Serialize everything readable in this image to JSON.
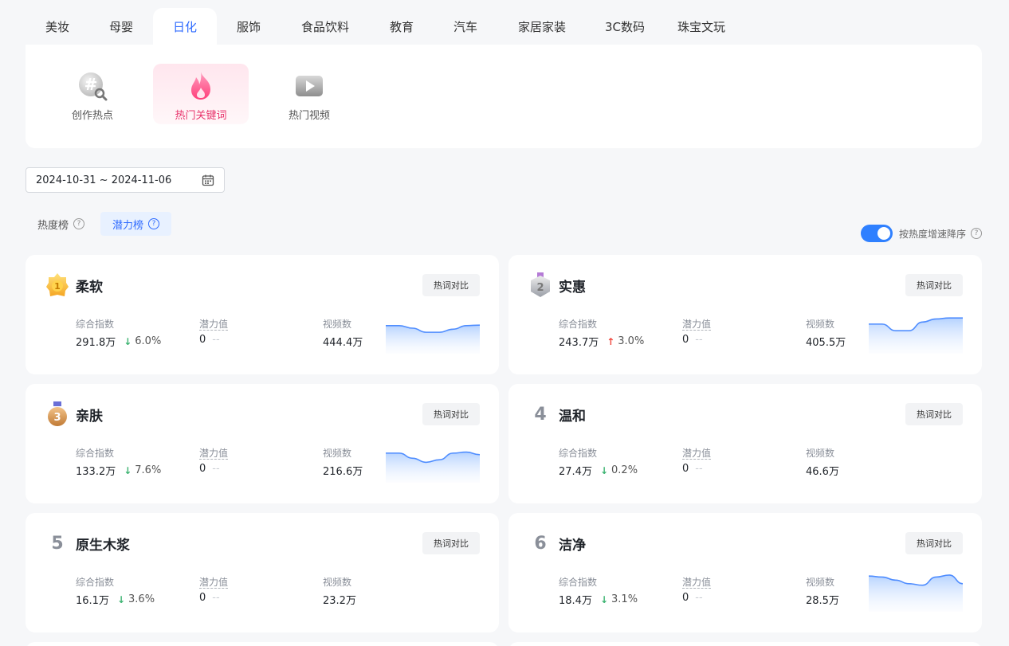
{
  "category_tabs": [
    {
      "label": "美妆",
      "active": false
    },
    {
      "label": "母婴",
      "active": false
    },
    {
      "label": "日化",
      "active": true
    },
    {
      "label": "服饰",
      "active": false
    },
    {
      "label": "食品饮料",
      "active": false
    },
    {
      "label": "教育",
      "active": false
    },
    {
      "label": "汽车",
      "active": false
    },
    {
      "label": "家居家装",
      "active": false
    },
    {
      "label": "3C数码",
      "active": false
    },
    {
      "label": "珠宝文玩",
      "active": false
    }
  ],
  "sub_nav": [
    {
      "label": "创作热点",
      "icon": "hashtag-search-icon",
      "active": false
    },
    {
      "label": "热门关键词",
      "icon": "fire-icon",
      "active": true
    },
    {
      "label": "热门视频",
      "icon": "video-play-icon",
      "active": false
    }
  ],
  "date_range": {
    "value": "2024-10-31 ~ 2024-11-06",
    "icon": "calendar-icon"
  },
  "rank_tabs": [
    {
      "label": "热度榜",
      "active": false
    },
    {
      "label": "潜力榜",
      "active": true
    }
  ],
  "sort_toggle": {
    "label": "按热度增速降序",
    "on": true
  },
  "stat_labels": {
    "composite": "综合指数",
    "potential": "潜力值",
    "videos": "视频数"
  },
  "compare_label": "热词对比",
  "colors": {
    "accent": "#2f6bff",
    "up": "#f0463c",
    "down": "#3cb371",
    "active_sub": "#e8336b"
  },
  "cards": [
    {
      "rank": "1",
      "keyword": "柔软",
      "composite": "291.8万",
      "trend": "down",
      "trend_pct": "6.0%",
      "potential": "0",
      "potential_change": "--",
      "videos": "444.4万",
      "spark": [
        0.55,
        0.55,
        0.5,
        0.42,
        0.42,
        0.48,
        0.55,
        0.56
      ],
      "has_spark": true
    },
    {
      "rank": "2",
      "keyword": "实惠",
      "composite": "243.7万",
      "trend": "up",
      "trend_pct": "3.0%",
      "potential": "0",
      "potential_change": "--",
      "videos": "405.5万",
      "spark": [
        0.58,
        0.58,
        0.45,
        0.45,
        0.62,
        0.68,
        0.7,
        0.7
      ],
      "has_spark": true
    },
    {
      "rank": "3",
      "keyword": "亲肤",
      "composite": "133.2万",
      "trend": "down",
      "trend_pct": "7.6%",
      "potential": "0",
      "potential_change": "--",
      "videos": "216.6万",
      "spark": [
        0.58,
        0.58,
        0.48,
        0.4,
        0.45,
        0.58,
        0.6,
        0.55
      ],
      "has_spark": true
    },
    {
      "rank": "4",
      "keyword": "温和",
      "composite": "27.4万",
      "trend": "down",
      "trend_pct": "0.2%",
      "potential": "0",
      "potential_change": "--",
      "videos": "46.6万",
      "spark": [],
      "has_spark": false
    },
    {
      "rank": "5",
      "keyword": "原生木浆",
      "composite": "16.1万",
      "trend": "down",
      "trend_pct": "3.6%",
      "potential": "0",
      "potential_change": "--",
      "videos": "23.2万",
      "spark": [],
      "has_spark": false
    },
    {
      "rank": "6",
      "keyword": "洁净",
      "composite": "18.4万",
      "trend": "down",
      "trend_pct": "3.1%",
      "potential": "0",
      "potential_change": "--",
      "videos": "28.5万",
      "spark": [
        0.7,
        0.68,
        0.62,
        0.55,
        0.52,
        0.68,
        0.72,
        0.55
      ],
      "has_spark": true
    }
  ]
}
